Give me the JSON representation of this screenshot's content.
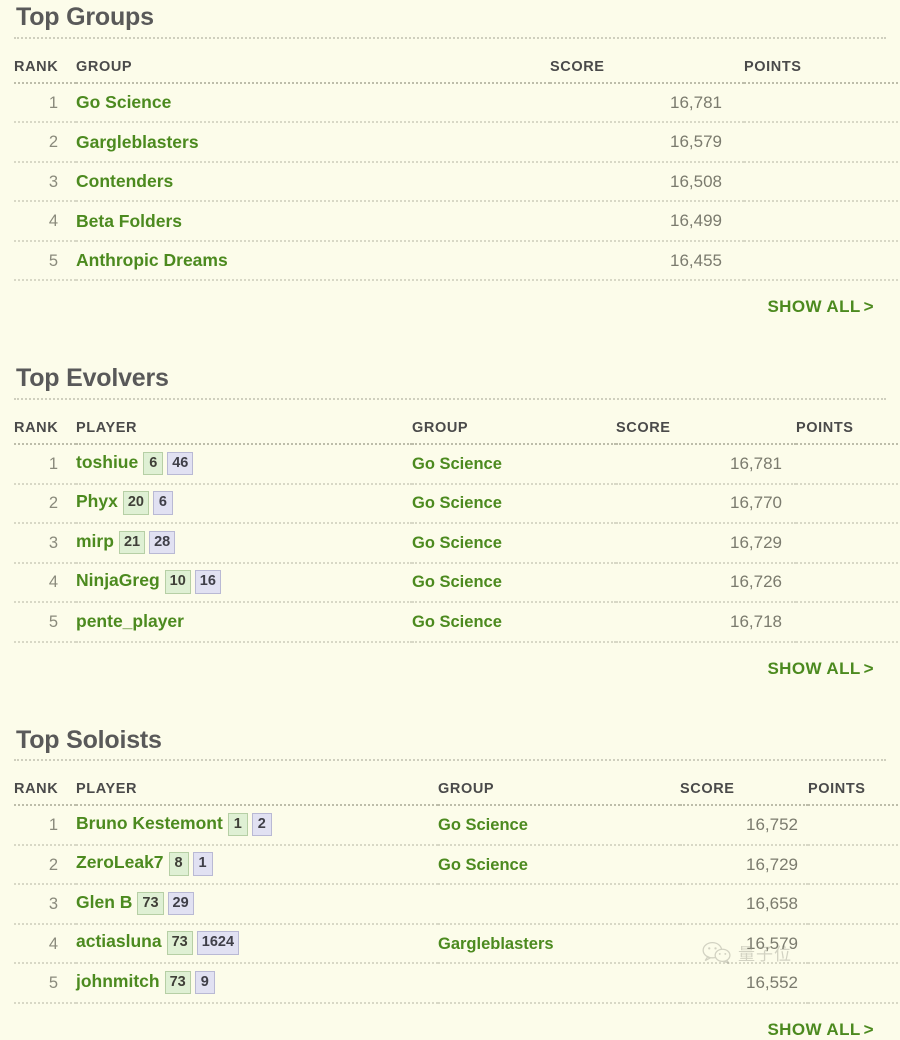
{
  "colors": {
    "page_bg": "#fcfcea",
    "accent_green": "#4c8a1f",
    "title_gray": "#595959",
    "text_gray": "#7d7d70",
    "badge_green_bg": "#dff0d4",
    "badge_purple_bg": "#e1e1f2"
  },
  "sections": [
    {
      "id": "top-groups",
      "title": "Top Groups",
      "type": "groups",
      "columns": [
        "RANK",
        "GROUP",
        "SCORE",
        "POINTS"
      ],
      "rows": [
        {
          "rank": "1",
          "name": "Go Science",
          "score": "16,781",
          "points": ""
        },
        {
          "rank": "2",
          "name": "Gargleblasters",
          "score": "16,579",
          "points": ""
        },
        {
          "rank": "3",
          "name": "Contenders",
          "score": "16,508",
          "points": ""
        },
        {
          "rank": "4",
          "name": "Beta Folders",
          "score": "16,499",
          "points": ""
        },
        {
          "rank": "5",
          "name": "Anthropic Dreams",
          "score": "16,455",
          "points": ""
        }
      ],
      "show_all": "SHOW ALL",
      "show_all_chevron": ">"
    },
    {
      "id": "top-evolvers",
      "title": "Top Evolvers",
      "type": "players",
      "columns": [
        "RANK",
        "PLAYER",
        "GROUP",
        "SCORE",
        "POINTS"
      ],
      "rows": [
        {
          "rank": "1",
          "name": "toshiue",
          "badge_green": "6",
          "badge_purple": "46",
          "group": "Go Science",
          "score": "16,781",
          "points": ""
        },
        {
          "rank": "2",
          "name": "Phyx",
          "badge_green": "20",
          "badge_purple": "6",
          "group": "Go Science",
          "score": "16,770",
          "points": ""
        },
        {
          "rank": "3",
          "name": "mirp",
          "badge_green": "21",
          "badge_purple": "28",
          "group": "Go Science",
          "score": "16,729",
          "points": ""
        },
        {
          "rank": "4",
          "name": "NinjaGreg",
          "badge_green": "10",
          "badge_purple": "16",
          "group": "Go Science",
          "score": "16,726",
          "points": ""
        },
        {
          "rank": "5",
          "name": "pente_player",
          "badge_green": "",
          "badge_purple": "",
          "group": "Go Science",
          "score": "16,718",
          "points": ""
        }
      ],
      "show_all": "SHOW ALL",
      "show_all_chevron": ">"
    },
    {
      "id": "top-soloists",
      "title": "Top Soloists",
      "type": "soloists",
      "columns": [
        "RANK",
        "PLAYER",
        "GROUP",
        "SCORE",
        "POINTS"
      ],
      "rows": [
        {
          "rank": "1",
          "name": "Bruno Kestemont",
          "badge_green": "1",
          "badge_purple": "2",
          "group": "Go Science",
          "score": "16,752",
          "points": ""
        },
        {
          "rank": "2",
          "name": "ZeroLeak7",
          "badge_green": "8",
          "badge_purple": "1",
          "group": "Go Science",
          "score": "16,729",
          "points": ""
        },
        {
          "rank": "3",
          "name": "Glen B",
          "badge_green": "73",
          "badge_purple": "29",
          "group": "",
          "score": "16,658",
          "points": ""
        },
        {
          "rank": "4",
          "name": "actiasluna",
          "badge_green": "73",
          "badge_purple": "1624",
          "group": "Gargleblasters",
          "score": "16,579",
          "points": ""
        },
        {
          "rank": "5",
          "name": "johnmitch",
          "badge_green": "73",
          "badge_purple": "9",
          "group": "",
          "score": "16,552",
          "points": ""
        }
      ],
      "show_all": "SHOW ALL",
      "show_all_chevron": ">"
    }
  ],
  "watermark": {
    "icon": "wechat-icon",
    "text": "量子位"
  }
}
